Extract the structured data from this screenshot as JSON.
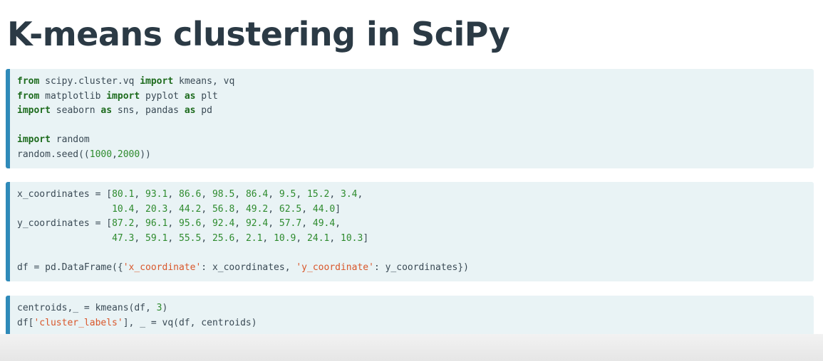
{
  "slide": {
    "title": "K-means clustering in SciPy"
  },
  "code_cells": [
    {
      "lines": [
        [
          {
            "t": "from",
            "k": "kw"
          },
          {
            "t": " scipy.cluster.vq "
          },
          {
            "t": "import",
            "k": "kw"
          },
          {
            "t": " kmeans, vq"
          }
        ],
        [
          {
            "t": "from",
            "k": "kw"
          },
          {
            "t": " matplotlib "
          },
          {
            "t": "import",
            "k": "kw"
          },
          {
            "t": " pyplot "
          },
          {
            "t": "as",
            "k": "kw"
          },
          {
            "t": " plt"
          }
        ],
        [
          {
            "t": "import",
            "k": "kw"
          },
          {
            "t": " seaborn "
          },
          {
            "t": "as",
            "k": "kw"
          },
          {
            "t": " sns, pandas "
          },
          {
            "t": "as",
            "k": "kw"
          },
          {
            "t": " pd"
          }
        ],
        [],
        [
          {
            "t": "import",
            "k": "kw"
          },
          {
            "t": " random"
          }
        ],
        [
          {
            "t": "random.seed(("
          },
          {
            "t": "1000",
            "k": "num"
          },
          {
            "t": ","
          },
          {
            "t": "2000",
            "k": "num"
          },
          {
            "t": "))"
          }
        ]
      ]
    },
    {
      "lines": [
        [
          {
            "t": "x_coordinates = ["
          },
          {
            "t": "80.1",
            "k": "num"
          },
          {
            "t": ", "
          },
          {
            "t": "93.1",
            "k": "num"
          },
          {
            "t": ", "
          },
          {
            "t": "86.6",
            "k": "num"
          },
          {
            "t": ", "
          },
          {
            "t": "98.5",
            "k": "num"
          },
          {
            "t": ", "
          },
          {
            "t": "86.4",
            "k": "num"
          },
          {
            "t": ", "
          },
          {
            "t": "9.5",
            "k": "num"
          },
          {
            "t": ", "
          },
          {
            "t": "15.2",
            "k": "num"
          },
          {
            "t": ", "
          },
          {
            "t": "3.4",
            "k": "num"
          },
          {
            "t": ","
          }
        ],
        [
          {
            "t": "                 "
          },
          {
            "t": "10.4",
            "k": "num"
          },
          {
            "t": ", "
          },
          {
            "t": "20.3",
            "k": "num"
          },
          {
            "t": ", "
          },
          {
            "t": "44.2",
            "k": "num"
          },
          {
            "t": ", "
          },
          {
            "t": "56.8",
            "k": "num"
          },
          {
            "t": ", "
          },
          {
            "t": "49.2",
            "k": "num"
          },
          {
            "t": ", "
          },
          {
            "t": "62.5",
            "k": "num"
          },
          {
            "t": ", "
          },
          {
            "t": "44.0",
            "k": "num"
          },
          {
            "t": "]"
          }
        ],
        [
          {
            "t": "y_coordinates = ["
          },
          {
            "t": "87.2",
            "k": "num"
          },
          {
            "t": ", "
          },
          {
            "t": "96.1",
            "k": "num"
          },
          {
            "t": ", "
          },
          {
            "t": "95.6",
            "k": "num"
          },
          {
            "t": ", "
          },
          {
            "t": "92.4",
            "k": "num"
          },
          {
            "t": ", "
          },
          {
            "t": "92.4",
            "k": "num"
          },
          {
            "t": ", "
          },
          {
            "t": "57.7",
            "k": "num"
          },
          {
            "t": ", "
          },
          {
            "t": "49.4",
            "k": "num"
          },
          {
            "t": ","
          }
        ],
        [
          {
            "t": "                 "
          },
          {
            "t": "47.3",
            "k": "num"
          },
          {
            "t": ", "
          },
          {
            "t": "59.1",
            "k": "num"
          },
          {
            "t": ", "
          },
          {
            "t": "55.5",
            "k": "num"
          },
          {
            "t": ", "
          },
          {
            "t": "25.6",
            "k": "num"
          },
          {
            "t": ", "
          },
          {
            "t": "2.1",
            "k": "num"
          },
          {
            "t": ", "
          },
          {
            "t": "10.9",
            "k": "num"
          },
          {
            "t": ", "
          },
          {
            "t": "24.1",
            "k": "num"
          },
          {
            "t": ", "
          },
          {
            "t": "10.3",
            "k": "num"
          },
          {
            "t": "]"
          }
        ],
        [],
        [
          {
            "t": "df = pd.DataFrame({"
          },
          {
            "t": "'x_coordinate'",
            "k": "str"
          },
          {
            "t": ": x_coordinates, "
          },
          {
            "t": "'y_coordinate'",
            "k": "str"
          },
          {
            "t": ": y_coordinates})"
          }
        ]
      ]
    },
    {
      "lines": [
        [
          {
            "t": "centroids,_ = kmeans(df, "
          },
          {
            "t": "3",
            "k": "num"
          },
          {
            "t": ")"
          }
        ],
        [
          {
            "t": "df["
          },
          {
            "t": "'cluster_labels'",
            "k": "str"
          },
          {
            "t": "], _ = vq(df, centroids)"
          }
        ]
      ]
    }
  ]
}
